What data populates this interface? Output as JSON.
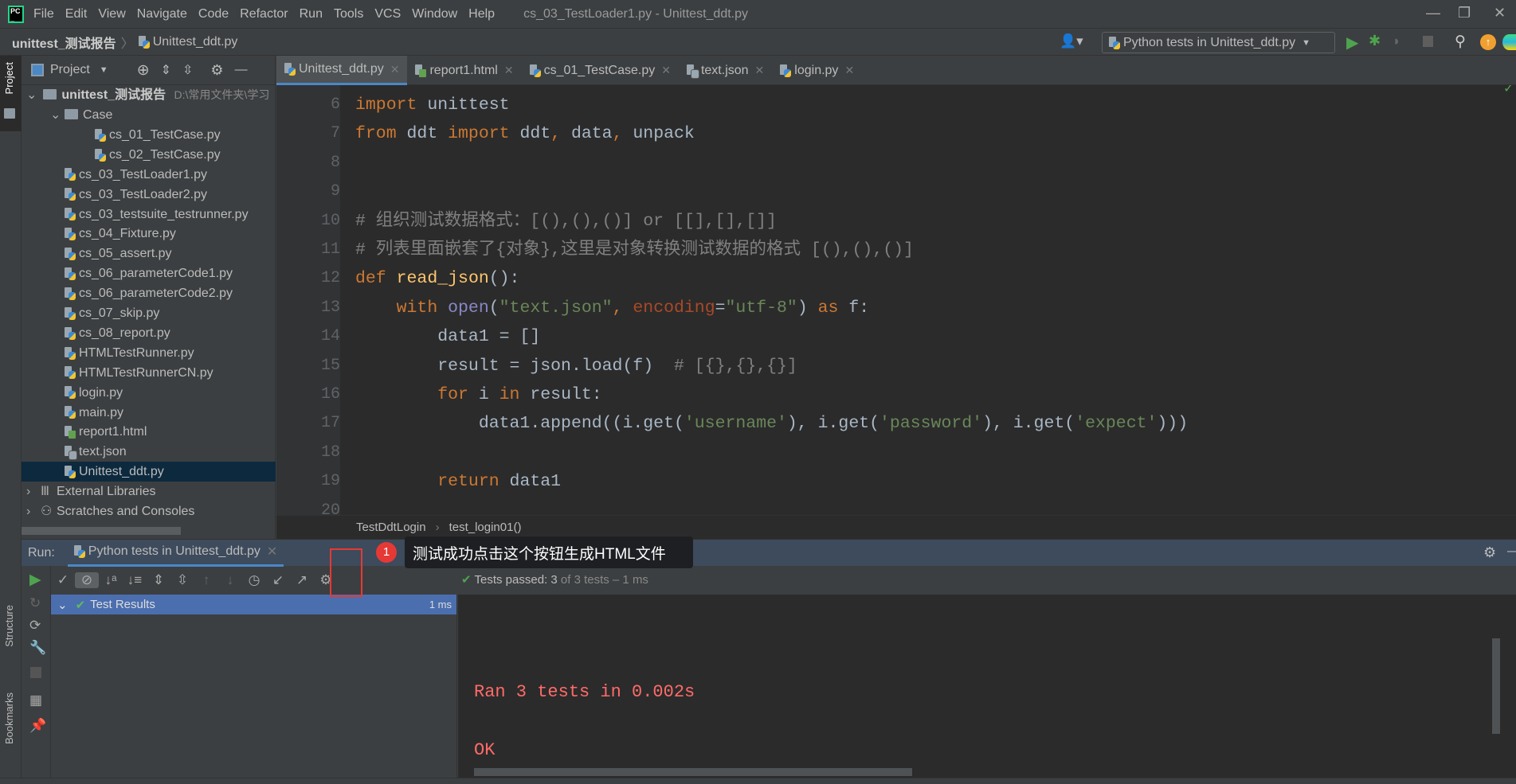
{
  "menubar": {
    "items": [
      "File",
      "Edit",
      "View",
      "Navigate",
      "Code",
      "Refactor",
      "Run",
      "Tools",
      "VCS",
      "Window",
      "Help"
    ],
    "title": "cs_03_TestLoader1.py - Unittest_ddt.py"
  },
  "navbar": {
    "project": "unittest_测试报告",
    "file": "Unittest_ddt.py",
    "run_config": "Python tests in Unittest_ddt.py"
  },
  "leftstrip": {
    "project": "Project",
    "structure": "Structure",
    "bookmarks": "Bookmarks"
  },
  "project_panel": {
    "title": "Project",
    "root": "unittest_测试报告",
    "root_path": "D:\\常用文件夹\\学习",
    "items": [
      {
        "label": "Case",
        "depth": 1,
        "type": "folder"
      },
      {
        "label": "cs_01_TestCase.py",
        "depth": 2,
        "type": "py"
      },
      {
        "label": "cs_02_TestCase.py",
        "depth": 2,
        "type": "py"
      },
      {
        "label": "cs_03_TestLoader1.py",
        "depth": 1,
        "type": "py"
      },
      {
        "label": "cs_03_TestLoader2.py",
        "depth": 1,
        "type": "py"
      },
      {
        "label": "cs_03_testsuite_testrunner.py",
        "depth": 1,
        "type": "py"
      },
      {
        "label": "cs_04_Fixture.py",
        "depth": 1,
        "type": "py"
      },
      {
        "label": "cs_05_assert.py",
        "depth": 1,
        "type": "py"
      },
      {
        "label": "cs_06_parameterCode1.py",
        "depth": 1,
        "type": "py"
      },
      {
        "label": "cs_06_parameterCode2.py",
        "depth": 1,
        "type": "py"
      },
      {
        "label": "cs_07_skip.py",
        "depth": 1,
        "type": "py"
      },
      {
        "label": "cs_08_report.py",
        "depth": 1,
        "type": "py"
      },
      {
        "label": "HTMLTestRunner.py",
        "depth": 1,
        "type": "py"
      },
      {
        "label": "HTMLTestRunnerCN.py",
        "depth": 1,
        "type": "py"
      },
      {
        "label": "login.py",
        "depth": 1,
        "type": "py"
      },
      {
        "label": "main.py",
        "depth": 1,
        "type": "py"
      },
      {
        "label": "report1.html",
        "depth": 1,
        "type": "html"
      },
      {
        "label": "text.json",
        "depth": 1,
        "type": "json"
      },
      {
        "label": "Unittest_ddt.py",
        "depth": 1,
        "type": "py",
        "selected": true
      },
      {
        "label": "External Libraries",
        "depth": 0,
        "type": "lib"
      },
      {
        "label": "Scratches and Consoles",
        "depth": 0,
        "type": "scratch"
      }
    ]
  },
  "tabs": [
    {
      "label": "Unittest_ddt.py",
      "icon": "py",
      "active": true
    },
    {
      "label": "report1.html",
      "icon": "html"
    },
    {
      "label": "cs_01_TestCase.py",
      "icon": "py"
    },
    {
      "label": "text.json",
      "icon": "json"
    },
    {
      "label": "login.py",
      "icon": "py"
    }
  ],
  "code": [
    {
      "n": "6",
      "tokens": [
        [
          "import",
          "kw"
        ],
        [
          " unittest",
          ""
        ]
      ]
    },
    {
      "n": "7",
      "tokens": [
        [
          "from",
          "kw"
        ],
        [
          " ddt ",
          ""
        ],
        [
          "import",
          "kw"
        ],
        [
          " ddt",
          ""
        ],
        [
          ",",
          "kw"
        ],
        [
          " data",
          ""
        ],
        [
          ",",
          "kw"
        ],
        [
          " unpack",
          ""
        ]
      ]
    },
    {
      "n": "8",
      "tokens": []
    },
    {
      "n": "9",
      "tokens": []
    },
    {
      "n": "10",
      "tokens": [
        [
          "# 组织测试数据格式：[(),(),()] or [[],[],[]]",
          "cm"
        ]
      ]
    },
    {
      "n": "11",
      "tokens": [
        [
          "# 列表里面嵌套了{对象},这里是对象转换测试数据的格式 [(),(),()]",
          "cm"
        ]
      ]
    },
    {
      "n": "12",
      "tokens": [
        [
          "def",
          "kw"
        ],
        [
          " ",
          ""
        ],
        [
          "read_json",
          "fn"
        ],
        [
          "():",
          ""
        ]
      ]
    },
    {
      "n": "13",
      "tokens": [
        [
          "    ",
          ""
        ],
        [
          "with",
          "kw"
        ],
        [
          " ",
          ""
        ],
        [
          "open",
          "bi"
        ],
        [
          "(",
          ""
        ],
        [
          "\"text.json\"",
          "str"
        ],
        [
          ", ",
          "kw"
        ],
        [
          "encoding",
          "kwa"
        ],
        [
          "=",
          ""
        ],
        [
          "\"utf-8\"",
          "str"
        ],
        [
          ") ",
          ""
        ],
        [
          "as",
          "kw"
        ],
        [
          " f:",
          ""
        ]
      ]
    },
    {
      "n": "14",
      "tokens": [
        [
          "        data1 = []",
          ""
        ]
      ]
    },
    {
      "n": "15",
      "tokens": [
        [
          "        result = json.load(f)  ",
          ""
        ],
        [
          "# [{},{},{}]",
          "cm"
        ]
      ]
    },
    {
      "n": "16",
      "tokens": [
        [
          "        ",
          ""
        ],
        [
          "for",
          "kw"
        ],
        [
          " i ",
          ""
        ],
        [
          "in",
          "kw"
        ],
        [
          " result:",
          ""
        ]
      ]
    },
    {
      "n": "17",
      "tokens": [
        [
          "            data1.append((i.get(",
          ""
        ],
        [
          "'username'",
          "str"
        ],
        [
          "), i.get(",
          ""
        ],
        [
          "'password'",
          "str"
        ],
        [
          "), i.get(",
          ""
        ],
        [
          "'expect'",
          "str"
        ],
        [
          ")))",
          ""
        ]
      ]
    },
    {
      "n": "18",
      "tokens": []
    },
    {
      "n": "19",
      "tokens": [
        [
          "        ",
          ""
        ],
        [
          "return",
          "kw"
        ],
        [
          " data1",
          ""
        ]
      ]
    },
    {
      "n": "20",
      "tokens": []
    }
  ],
  "breadcrumb": [
    "TestDdtLogin",
    "test_login01()"
  ],
  "run": {
    "label": "Run:",
    "tab": "Python tests in Unittest_ddt.py",
    "status_prefix": "Tests passed:",
    "status_count": "3",
    "status_suffix": "of 3 tests – 1 ms",
    "results_label": "Test Results",
    "results_time": "1 ms",
    "console": [
      "Ran 3 tests in 0.002s",
      "OK"
    ]
  },
  "annotation": {
    "badge": "1",
    "text": "测试成功点击这个按钮生成HTML文件"
  },
  "colors": {
    "accent": "#4a88c7",
    "keyword": "#cc7832",
    "string": "#6a8759",
    "comment": "#808080",
    "console_error": "#ff6b68",
    "annotation": "#e53935"
  }
}
